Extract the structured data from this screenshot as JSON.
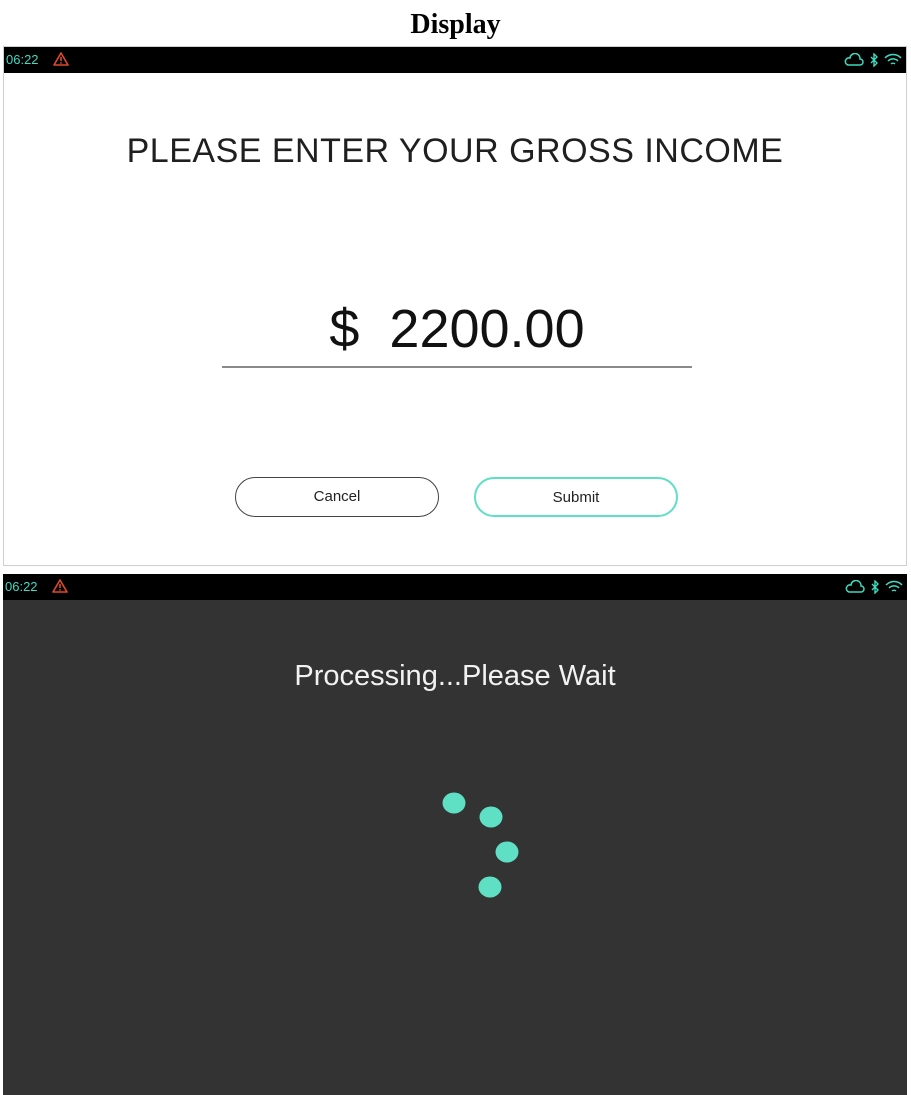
{
  "page_title": "Display",
  "status_bar": {
    "time": "06:22",
    "time_color": "#3ddbc0",
    "warning_color": "#e0492a",
    "icons": [
      "warning-icon",
      "cloud-icon",
      "bluetooth-icon",
      "wifi-icon"
    ],
    "icon_color": "#3ddbc0"
  },
  "income_screen": {
    "prompt": "PLEASE ENTER YOUR GROSS INCOME",
    "currency_symbol": "$",
    "amount": "2200.00",
    "cancel_label": "Cancel",
    "submit_label": "Submit",
    "accent_color": "#5fe0c4"
  },
  "processing_screen": {
    "message": "Processing...Please Wait",
    "spinner_icon": "loading-spinner-icon",
    "spinner_color": "#5fe0c4",
    "background": "#333333"
  }
}
